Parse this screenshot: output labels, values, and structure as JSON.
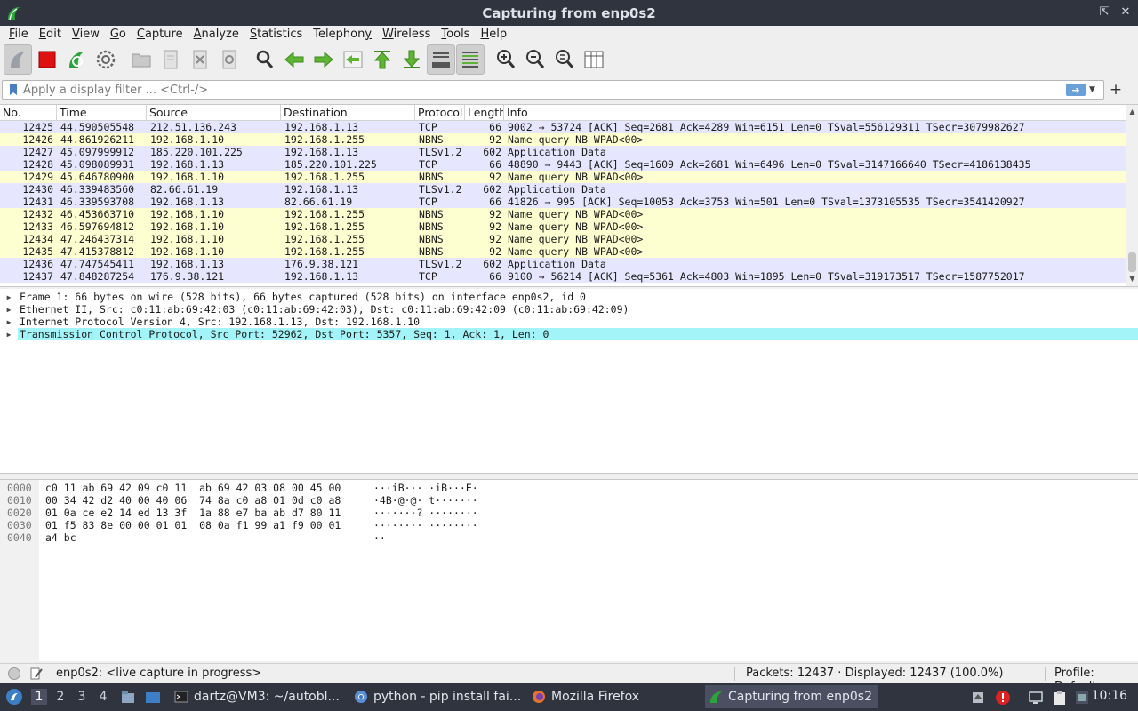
{
  "window": {
    "title": "Capturing from enp0s2"
  },
  "menu": [
    {
      "label": "File",
      "key": "F",
      "rest": "ile"
    },
    {
      "label": "Edit",
      "key": "E",
      "rest": "dit"
    },
    {
      "label": "View",
      "key": "V",
      "rest": "iew"
    },
    {
      "label": "Go",
      "key": "G",
      "rest": "o"
    },
    {
      "label": "Capture",
      "key": "C",
      "rest": "apture"
    },
    {
      "label": "Analyze",
      "key": "A",
      "rest": "nalyze"
    },
    {
      "label": "Statistics",
      "key": "S",
      "rest": "tatistics"
    },
    {
      "label": "Telephony",
      "key": "y",
      "rest": "Telephon"
    },
    {
      "label": "Wireless",
      "key": "W",
      "rest": "ireless"
    },
    {
      "label": "Tools",
      "key": "T",
      "rest": "ools"
    },
    {
      "label": "Help",
      "key": "H",
      "rest": "elp"
    }
  ],
  "filter": {
    "placeholder": "Apply a display filter ... <Ctrl-/>",
    "value": ""
  },
  "columns": {
    "no": "No.",
    "time": "Time",
    "source": "Source",
    "destination": "Destination",
    "protocol": "Protocol",
    "length": "Length",
    "info": "Info"
  },
  "packets": [
    {
      "no": "12425",
      "time": "44.590505548",
      "src": "212.51.136.243",
      "dst": "192.168.1.13",
      "proto": "TCP",
      "len": "66",
      "info": "9002 → 53724 [ACK] Seq=2681 Ack=4289 Win=6151 Len=0 TSval=556129311 TSecr=3079982627",
      "bg": "#e7e6ff"
    },
    {
      "no": "12426",
      "time": "44.861926211",
      "src": "192.168.1.10",
      "dst": "192.168.1.255",
      "proto": "NBNS",
      "len": "92",
      "info": "Name query NB WPAD<00>",
      "bg": "#feffd0"
    },
    {
      "no": "12427",
      "time": "45.097999912",
      "src": "185.220.101.225",
      "dst": "192.168.1.13",
      "proto": "TLSv1.2",
      "len": "602",
      "info": "Application Data",
      "bg": "#e7e6ff"
    },
    {
      "no": "12428",
      "time": "45.098089931",
      "src": "192.168.1.13",
      "dst": "185.220.101.225",
      "proto": "TCP",
      "len": "66",
      "info": "48890 → 9443 [ACK] Seq=1609 Ack=2681 Win=6496 Len=0 TSval=3147166640 TSecr=4186138435",
      "bg": "#e7e6ff"
    },
    {
      "no": "12429",
      "time": "45.646780900",
      "src": "192.168.1.10",
      "dst": "192.168.1.255",
      "proto": "NBNS",
      "len": "92",
      "info": "Name query NB WPAD<00>",
      "bg": "#feffd0"
    },
    {
      "no": "12430",
      "time": "46.339483560",
      "src": "82.66.61.19",
      "dst": "192.168.1.13",
      "proto": "TLSv1.2",
      "len": "602",
      "info": "Application Data",
      "bg": "#e7e6ff"
    },
    {
      "no": "12431",
      "time": "46.339593708",
      "src": "192.168.1.13",
      "dst": "82.66.61.19",
      "proto": "TCP",
      "len": "66",
      "info": "41826 → 995 [ACK] Seq=10053 Ack=3753 Win=501 Len=0 TSval=1373105535 TSecr=3541420927",
      "bg": "#e7e6ff"
    },
    {
      "no": "12432",
      "time": "46.453663710",
      "src": "192.168.1.10",
      "dst": "192.168.1.255",
      "proto": "NBNS",
      "len": "92",
      "info": "Name query NB WPAD<00>",
      "bg": "#feffd0"
    },
    {
      "no": "12433",
      "time": "46.597694812",
      "src": "192.168.1.10",
      "dst": "192.168.1.255",
      "proto": "NBNS",
      "len": "92",
      "info": "Name query NB WPAD<00>",
      "bg": "#feffd0"
    },
    {
      "no": "12434",
      "time": "47.246437314",
      "src": "192.168.1.10",
      "dst": "192.168.1.255",
      "proto": "NBNS",
      "len": "92",
      "info": "Name query NB WPAD<00>",
      "bg": "#feffd0"
    },
    {
      "no": "12435",
      "time": "47.415378812",
      "src": "192.168.1.10",
      "dst": "192.168.1.255",
      "proto": "NBNS",
      "len": "92",
      "info": "Name query NB WPAD<00>",
      "bg": "#feffd0"
    },
    {
      "no": "12436",
      "time": "47.747545411",
      "src": "192.168.1.13",
      "dst": "176.9.38.121",
      "proto": "TLSv1.2",
      "len": "602",
      "info": "Application Data",
      "bg": "#e7e6ff"
    },
    {
      "no": "12437",
      "time": "47.848287254",
      "src": "176.9.38.121",
      "dst": "192.168.1.13",
      "proto": "TCP",
      "len": "66",
      "info": "9100 → 56214 [ACK] Seq=5361 Ack=4803 Win=1895 Len=0 TSval=319173517 TSecr=1587752017",
      "bg": "#e7e6ff"
    }
  ],
  "details": [
    {
      "text": "Frame 1: 66 bytes on wire (528 bits), 66 bytes captured (528 bits) on interface enp0s2, id 0",
      "selected": false
    },
    {
      "text": "Ethernet II, Src: c0:11:ab:69:42:03 (c0:11:ab:69:42:03), Dst: c0:11:ab:69:42:09 (c0:11:ab:69:42:09)",
      "selected": false
    },
    {
      "text": "Internet Protocol Version 4, Src: 192.168.1.13, Dst: 192.168.1.10",
      "selected": false
    },
    {
      "text": "Transmission Control Protocol, Src Port: 52962, Dst Port: 5357, Seq: 1, Ack: 1, Len: 0",
      "selected": true
    }
  ],
  "hex": [
    {
      "off": "0000",
      "bytes": "c0 11 ab 69 42 09 c0 11  ab 69 42 03 08 00 45 00",
      "ascii": "···iB··· ·iB···E·"
    },
    {
      "off": "0010",
      "bytes": "00 34 42 d2 40 00 40 06  74 8a c0 a8 01 0d c0 a8",
      "ascii": "·4B·@·@· t·······"
    },
    {
      "off": "0020",
      "bytes": "01 0a ce e2 14 ed 13 3f  1a 88 e7 ba ab d7 80 11",
      "ascii": "·······? ········"
    },
    {
      "off": "0030",
      "bytes": "01 f5 83 8e 00 00 01 01  08 0a f1 99 a1 f9 00 01",
      "ascii": "········ ········"
    },
    {
      "off": "0040",
      "bytes": "a4 bc",
      "ascii": "··"
    }
  ],
  "status": {
    "message": "enp0s2: <live capture in progress>",
    "packets": "Packets: 12437 · Displayed: 12437 (100.0%)",
    "profile": "Profile: Default"
  },
  "taskbar": {
    "workspaces": [
      "1",
      "2",
      "3",
      "4"
    ],
    "tasks": [
      {
        "label": "dartz@VM3: ~/autobl...",
        "icon": "terminal-icon"
      },
      {
        "label": "python - pip install fai...",
        "icon": "chrome-icon"
      },
      {
        "label": "Mozilla Firefox",
        "icon": "firefox-icon"
      },
      {
        "label": "Capturing from enp0s2",
        "icon": "wireshark-icon"
      }
    ],
    "clock": "10:16"
  },
  "colors": {
    "tcp_row": "#e7e6ff",
    "nbns_row": "#feffd0",
    "selected_detail": "#a3f4f8",
    "titlebar": "#2f343f"
  }
}
